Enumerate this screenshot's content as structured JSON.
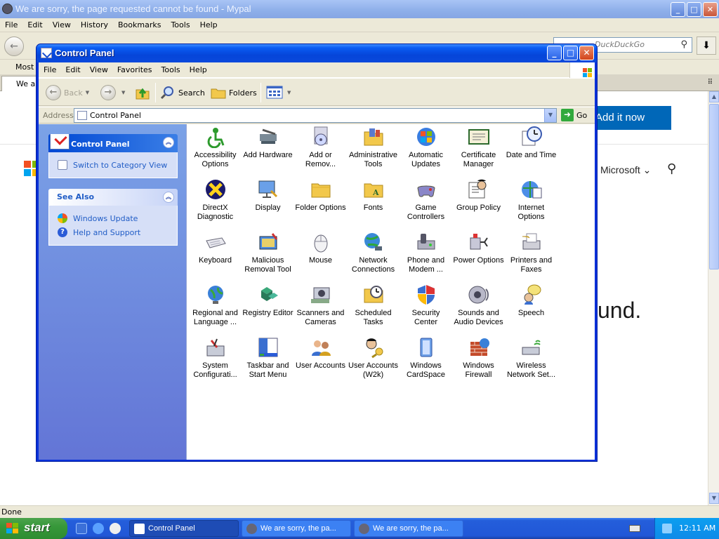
{
  "browser": {
    "title": "We are sorry, the page requested cannot be found - Mypal",
    "menu": [
      "File",
      "Edit",
      "View",
      "History",
      "Bookmarks",
      "Tools",
      "Help"
    ],
    "search_placeholder": "DuckDuckGo",
    "bookmark_label": "Most V",
    "tab_label": "We ar",
    "add_button": "Add it now",
    "brand": "Microsoft",
    "heading_fragment": "und.",
    "status": "Done"
  },
  "control_panel": {
    "title": "Control Panel",
    "menu": [
      "File",
      "Edit",
      "View",
      "Favorites",
      "Tools",
      "Help"
    ],
    "toolbar": {
      "back": "Back",
      "search": "Search",
      "folders": "Folders"
    },
    "address_label": "Address",
    "address_value": "Control Panel",
    "go_label": "Go",
    "sidebar": {
      "main_title": "Control Panel",
      "switch_link": "Switch to Category View",
      "see_also_title": "See Also",
      "see_also_links": [
        "Windows Update",
        "Help and Support"
      ]
    },
    "items": [
      {
        "label": "Accessibility Options",
        "icon": "accessibility-icon"
      },
      {
        "label": "Add Hardware",
        "icon": "add-hardware-icon"
      },
      {
        "label": "Add or Remov...",
        "icon": "add-remove-programs-icon"
      },
      {
        "label": "Administrative Tools",
        "icon": "administrative-tools-icon"
      },
      {
        "label": "Automatic Updates",
        "icon": "automatic-updates-icon"
      },
      {
        "label": "Certificate Manager",
        "icon": "certificate-manager-icon"
      },
      {
        "label": "Date and Time",
        "icon": "date-time-icon"
      },
      {
        "label": "DirectX Diagnostic",
        "icon": "directx-icon"
      },
      {
        "label": "Display",
        "icon": "display-icon"
      },
      {
        "label": "Folder Options",
        "icon": "folder-options-icon"
      },
      {
        "label": "Fonts",
        "icon": "fonts-icon"
      },
      {
        "label": "Game Controllers",
        "icon": "game-controllers-icon"
      },
      {
        "label": "Group Policy",
        "icon": "group-policy-icon"
      },
      {
        "label": "Internet Options",
        "icon": "internet-options-icon"
      },
      {
        "label": "Keyboard",
        "icon": "keyboard-icon"
      },
      {
        "label": "Malicious Removal Tool",
        "icon": "malicious-removal-tool-icon"
      },
      {
        "label": "Mouse",
        "icon": "mouse-icon"
      },
      {
        "label": "Network Connections",
        "icon": "network-connections-icon"
      },
      {
        "label": "Phone and Modem ...",
        "icon": "phone-modem-icon"
      },
      {
        "label": "Power Options",
        "icon": "power-options-icon"
      },
      {
        "label": "Printers and Faxes",
        "icon": "printers-faxes-icon"
      },
      {
        "label": "Regional and Language ...",
        "icon": "regional-language-icon"
      },
      {
        "label": "Registry Editor",
        "icon": "registry-editor-icon"
      },
      {
        "label": "Scanners and Cameras",
        "icon": "scanners-cameras-icon"
      },
      {
        "label": "Scheduled Tasks",
        "icon": "scheduled-tasks-icon"
      },
      {
        "label": "Security Center",
        "icon": "security-center-icon"
      },
      {
        "label": "Sounds and Audio Devices",
        "icon": "sounds-audio-icon"
      },
      {
        "label": "Speech",
        "icon": "speech-icon"
      },
      {
        "label": "System Configurati...",
        "icon": "system-configuration-icon"
      },
      {
        "label": "Taskbar and Start Menu",
        "icon": "taskbar-start-menu-icon"
      },
      {
        "label": "User Accounts",
        "icon": "user-accounts-icon"
      },
      {
        "label": "User Accounts (W2k)",
        "icon": "user-accounts-w2k-icon"
      },
      {
        "label": "Windows CardSpace",
        "icon": "cardspace-icon"
      },
      {
        "label": "Windows Firewall",
        "icon": "firewall-icon"
      },
      {
        "label": "Wireless Network Set...",
        "icon": "wireless-network-icon"
      }
    ]
  },
  "taskbar": {
    "start_label": "start",
    "tasks": [
      "Control Panel",
      "We are sorry, the pa...",
      "We are sorry, the pa..."
    ],
    "clock": "12:11 AM"
  },
  "colors": {
    "xp_blue": "#0a49dc",
    "task_pane": "#6375d6",
    "start_green": "#37983a",
    "ms_blue": "#0067b8"
  }
}
